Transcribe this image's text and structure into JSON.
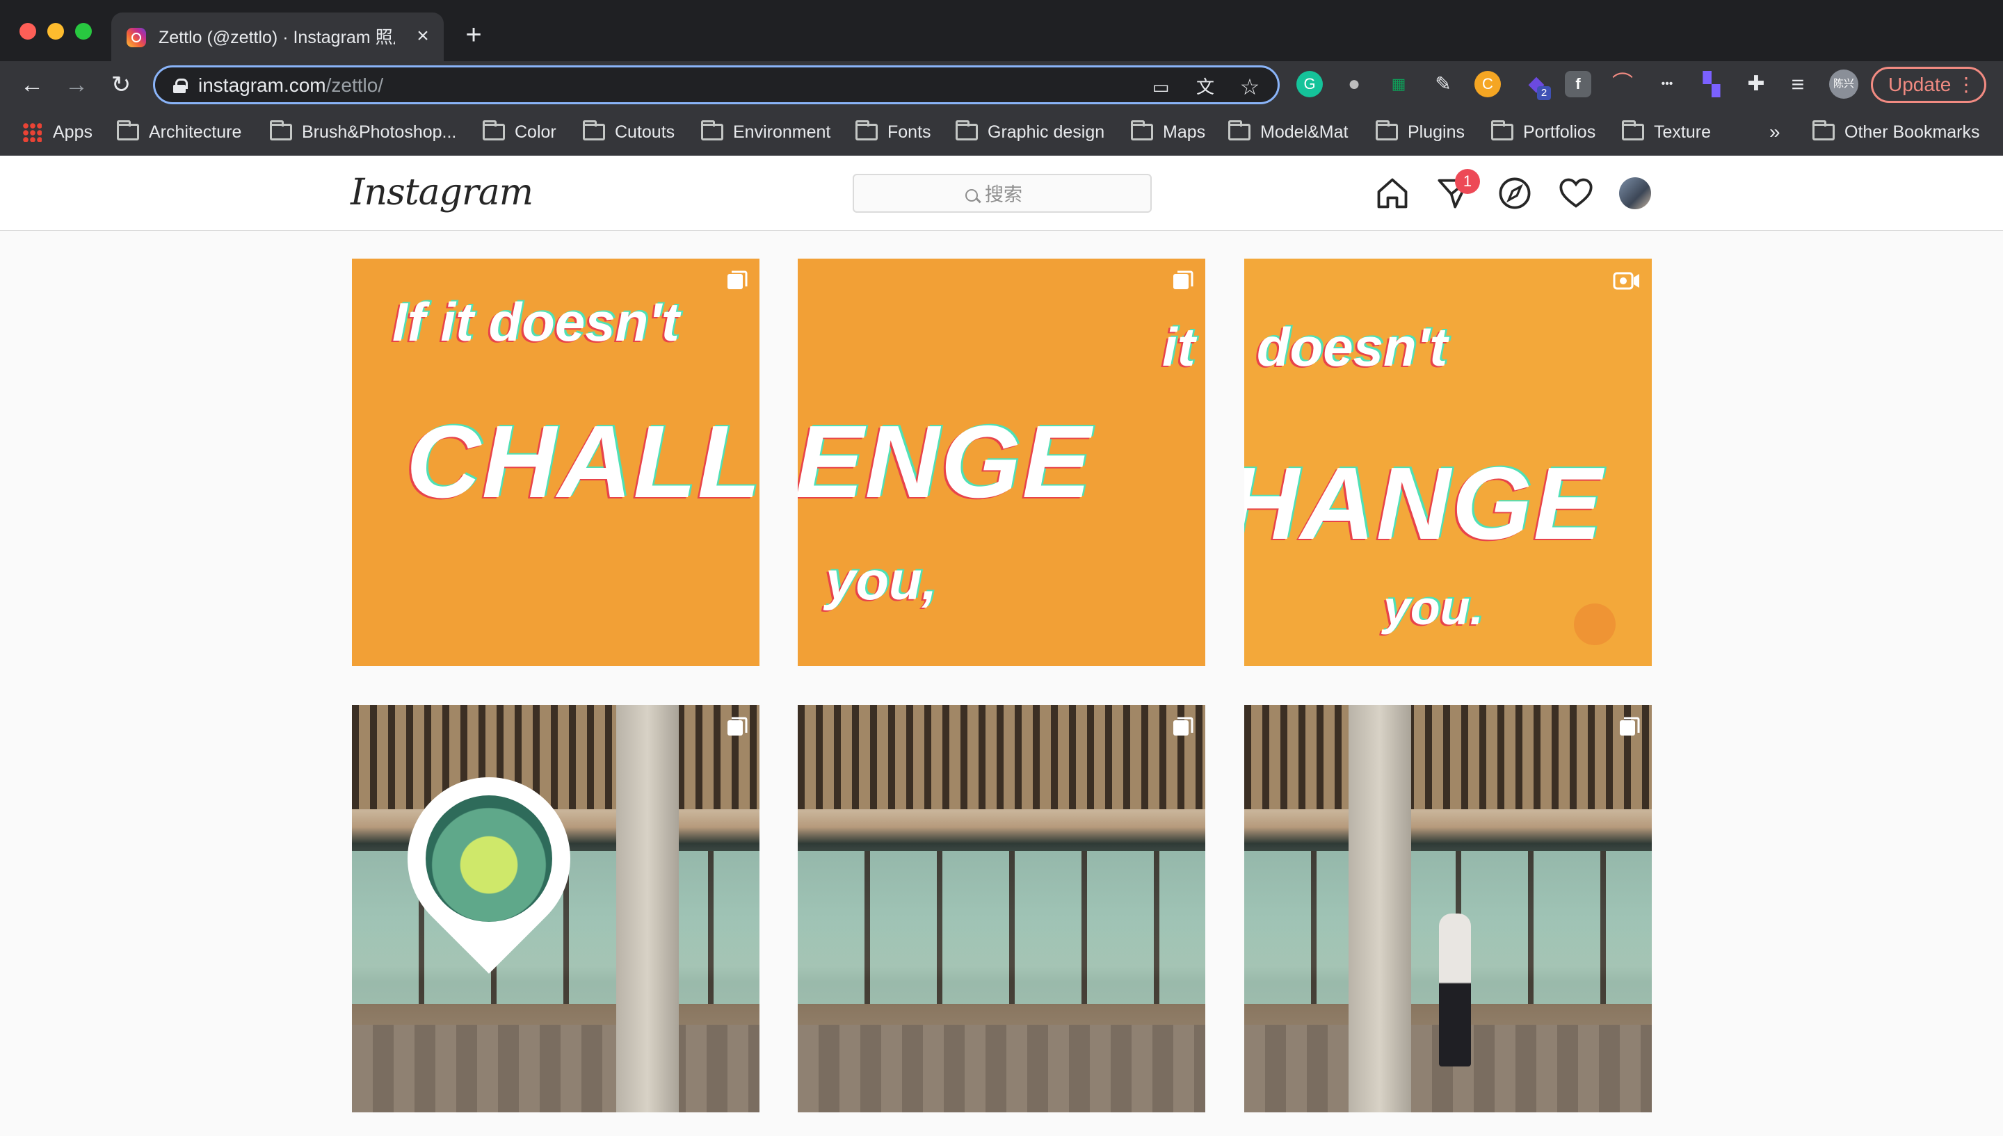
{
  "browser": {
    "tab": {
      "title": "Zettlo (@zettlo) · Instagram 照片和视频",
      "close": "×"
    },
    "new_tab": "+",
    "nav": {
      "back": "←",
      "forward": "→",
      "reload": "↻"
    },
    "url": {
      "host": "instagram.com",
      "path": "/zettlo/"
    },
    "omnibox_icons": {
      "cast": "▭",
      "translate": "文",
      "bookmark_star": "☆"
    },
    "update_button": {
      "label": "Update",
      "menu": "⋮"
    },
    "extensions": [
      {
        "name": "grammarly-icon",
        "glyph": "G",
        "color": "#15c39a"
      },
      {
        "name": "globe-ext-icon",
        "glyph": "●",
        "color": "#bdbdbd"
      },
      {
        "name": "sheet-ext-icon",
        "glyph": "▦",
        "color": "#0f9d58"
      },
      {
        "name": "pen-ext-icon",
        "glyph": "✎",
        "color": "#5f6368"
      },
      {
        "name": "coupon-ext-icon",
        "glyph": "C",
        "color": "#f5a623"
      },
      {
        "name": "stack-ext-icon",
        "glyph": "◆",
        "color": "#5b3bd6"
      },
      {
        "name": "facebook-ext-icon",
        "glyph": "f",
        "color": "#5f6368"
      },
      {
        "name": "rainbow-ext-icon",
        "glyph": "⌒",
        "color": "#5f6368"
      },
      {
        "name": "dots-ext-icon",
        "glyph": "•••",
        "color": "#5f6368"
      },
      {
        "name": "grid-ext-icon",
        "glyph": "▚",
        "color": "#7b61ff"
      },
      {
        "name": "puzzle-icon",
        "glyph": "✚",
        "color": "#5f6368"
      },
      {
        "name": "playlist-icon",
        "glyph": "≡",
        "color": "#5f6368"
      },
      {
        "name": "profile-avatar-icon",
        "glyph": "陈兴",
        "color": "#8a8f98"
      }
    ],
    "ext_badges": {
      "stack": "2"
    },
    "bookmarks": [
      {
        "label": "Apps",
        "type": "apps"
      },
      {
        "label": "Architecture"
      },
      {
        "label": "Brush&Photoshop..."
      },
      {
        "label": "Color"
      },
      {
        "label": "Cutouts"
      },
      {
        "label": "Environment"
      },
      {
        "label": "Fonts"
      },
      {
        "label": "Graphic design"
      },
      {
        "label": "Maps"
      },
      {
        "label": "Model&Mat"
      },
      {
        "label": "Plugins"
      },
      {
        "label": "Portfolios"
      },
      {
        "label": "Texture"
      }
    ],
    "bookmarks_more": "»",
    "other_bookmarks": "Other Bookmarks"
  },
  "instagram": {
    "logo": "Instagram",
    "search_placeholder": "搜索",
    "direct_badge": "1",
    "posts": [
      {
        "text_small": "If it doesn't",
        "text_big": "CHALL",
        "type": "carousel"
      },
      {
        "text_small": "it",
        "text_big": "ENGE",
        "text_bottom": "you,",
        "type": "carousel"
      },
      {
        "text_small": "doesn't",
        "text_big": "HANGE",
        "text_bottom": "you.",
        "type": "video"
      },
      {
        "type": "carousel",
        "scene": "storefront-with-map-pin"
      },
      {
        "type": "carousel",
        "scene": "storefront-windows"
      },
      {
        "type": "carousel",
        "scene": "storefront-person"
      }
    ],
    "colors": {
      "post_orange": "#f2a036",
      "badge_red": "#ed4956"
    }
  }
}
